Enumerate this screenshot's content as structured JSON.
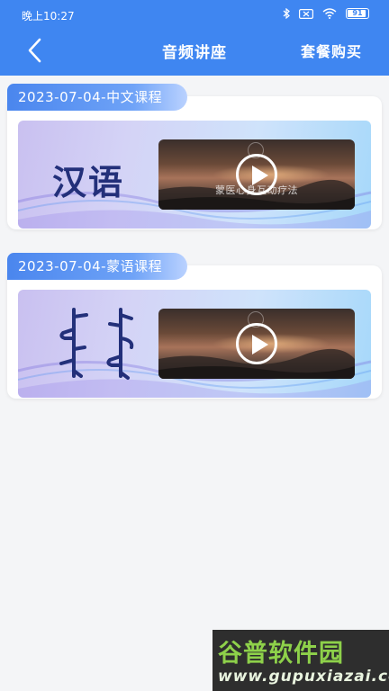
{
  "status_bar": {
    "time": "晚上10:27",
    "battery": "91"
  },
  "header": {
    "title": "音频讲座",
    "action_label": "套餐购买"
  },
  "courses": [
    {
      "date_label": "2023-07-04-中文课程",
      "banner_text": "汉语",
      "video_caption": "蒙医心身互动疗法"
    },
    {
      "date_label": "2023-07-04-蒙语课程",
      "banner_text": "",
      "video_caption": ""
    }
  ],
  "watermark": {
    "brand": "谷普软件园",
    "url": "www.gupuxiazai.com"
  },
  "colors": {
    "header": "#3f86f1",
    "tab": "#4a86ee",
    "banner_text": "#23307a"
  }
}
